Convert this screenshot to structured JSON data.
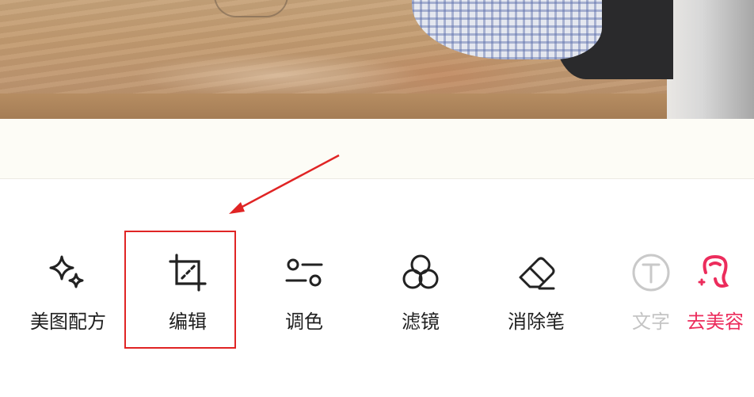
{
  "toolbar": {
    "items": [
      {
        "label": "美图配方",
        "icon": "sparkle-icon"
      },
      {
        "label": "编辑",
        "icon": "crop-icon"
      },
      {
        "label": "调色",
        "icon": "adjust-sliders-icon"
      },
      {
        "label": "滤镜",
        "icon": "filter-circles-icon"
      },
      {
        "label": "消除笔",
        "icon": "eraser-icon"
      },
      {
        "label": "文字",
        "icon": "text-icon"
      },
      {
        "label": "去美容",
        "icon": "beauty-face-icon"
      }
    ]
  },
  "annotation": {
    "highlight_target": "编辑",
    "box_color": "#e02424",
    "arrow_color": "#e02424"
  },
  "colors": {
    "label_text": "#1f1f1f",
    "faded_text": "#c4c4c4",
    "accent_pink": "#ec2c5c"
  }
}
